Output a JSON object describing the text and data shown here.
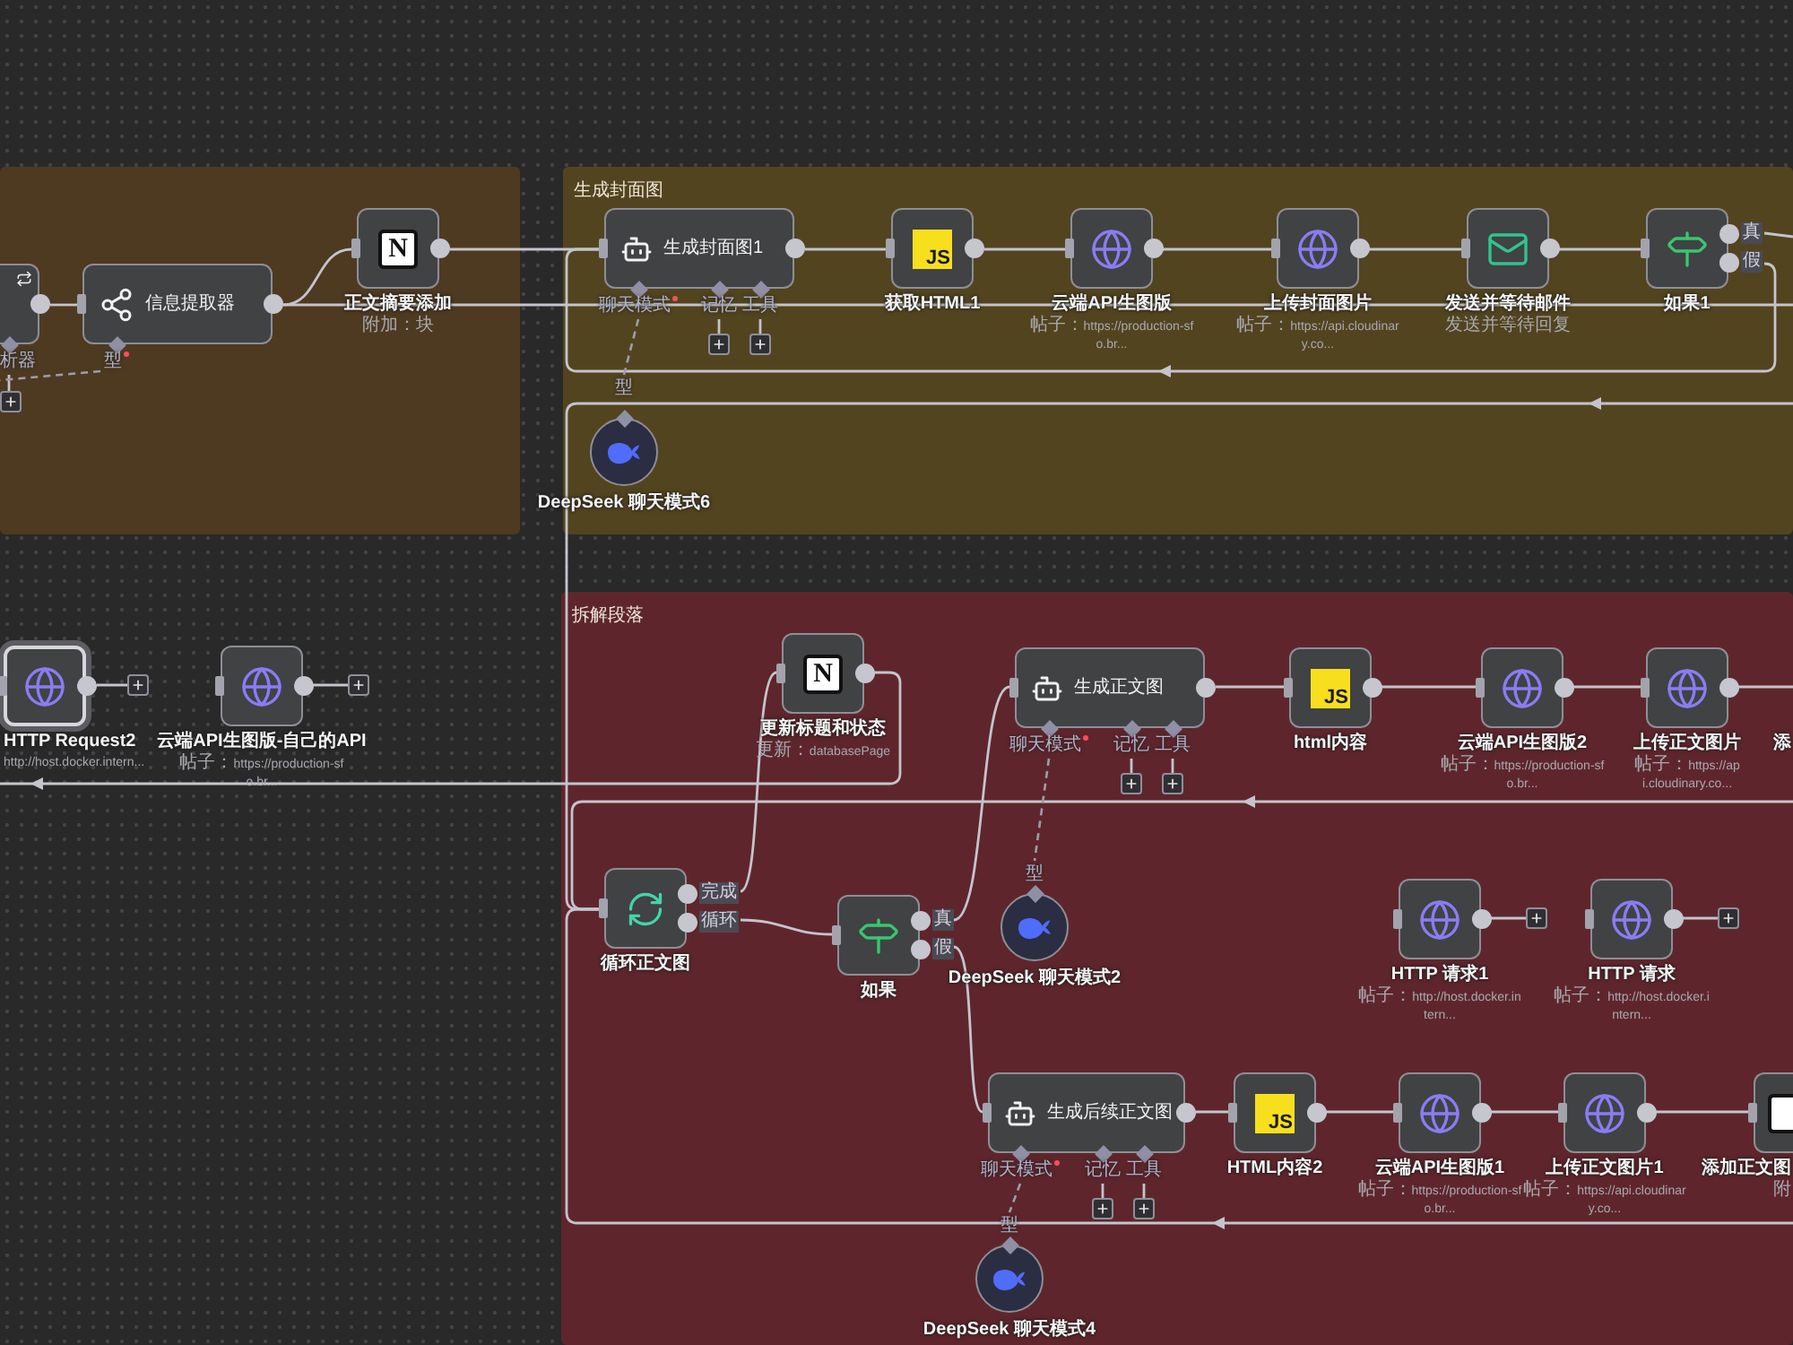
{
  "groups": [
    {
      "color": "#4e3a21"
    },
    {
      "title": "生成封面图",
      "color": "#52441f"
    },
    {
      "title": "拆解段落",
      "color": "#5e262c"
    }
  ],
  "nodes": [
    {
      "kind": "chain",
      "selected": false,
      "ports": [
        {
          "label": "析器",
          "required": false
        }
      ]
    },
    {
      "kind": "extractor",
      "title": "信息提取器",
      "selected": false,
      "ports": [
        {
          "label": "型",
          "required": true
        }
      ]
    },
    {
      "kind": "notion",
      "logo": "N",
      "label": "正文摘要添加",
      "subtitle": "附加：块",
      "selected": false
    },
    {
      "kind": "agent",
      "title": "生成封面图1",
      "selected": false,
      "ports": [
        {
          "label": "聊天模式",
          "required": true
        },
        {
          "label": "记忆",
          "required": false
        },
        {
          "label": "工具",
          "required": false
        }
      ]
    },
    {
      "kind": "code",
      "logo": "JS",
      "label": "获取HTML1",
      "selected": false
    },
    {
      "kind": "http",
      "label": "云端API生图版",
      "subtitle": "帖子：https://production-sfo.br...",
      "selected": false
    },
    {
      "kind": "http",
      "label": "上传封面图片",
      "subtitle": "帖子：https://api.cloudinary.co...",
      "selected": false
    },
    {
      "kind": "email",
      "label": "发送并等待邮件",
      "subtitle": "发送并等待回复",
      "selected": false
    },
    {
      "kind": "if",
      "label": "如果1",
      "outputs": [
        "真",
        "假"
      ],
      "selected": false
    },
    {
      "kind": "model",
      "label": "DeepSeek 聊天模式6",
      "port": "型",
      "selected": false
    },
    {
      "kind": "http",
      "label": "HTTP Request2",
      "subtitle": "http://host.docker.intern...",
      "selected": true
    },
    {
      "kind": "http",
      "label": "云端API生图版-自己的API",
      "subtitle": "帖子：https://production-sfo.br...",
      "selected": false
    },
    {
      "kind": "notion",
      "logo": "N",
      "label": "更新标题和状态",
      "subtitle": "更新：databasePage",
      "selected": false
    },
    {
      "kind": "agent",
      "title": "生成正文图",
      "selected": false,
      "ports": [
        {
          "label": "聊天模式",
          "required": true
        },
        {
          "label": "记忆",
          "required": false
        },
        {
          "label": "工具",
          "required": false
        }
      ]
    },
    {
      "kind": "code",
      "logo": "JS",
      "label": "html内容",
      "selected": false
    },
    {
      "kind": "http",
      "label": "云端API生图版2",
      "subtitle": "帖子：https://production-sfo.br...",
      "selected": false
    },
    {
      "kind": "http",
      "label": "上传正文图片",
      "subtitle": "帖子：https://api.cloudinary.co...",
      "selected": false
    },
    {
      "label": "添"
    },
    {
      "kind": "loop",
      "label": "循环正文图",
      "outputs": [
        "完成",
        "循环"
      ],
      "selected": false
    },
    {
      "kind": "if",
      "label": "如果",
      "outputs": [
        "真",
        "假"
      ],
      "selected": false
    },
    {
      "kind": "model",
      "label": "DeepSeek 聊天模式2",
      "port": "型",
      "selected": false
    },
    {
      "kind": "http",
      "label": "HTTP 请求1",
      "subtitle": "帖子：http://host.docker.intern...",
      "selected": false
    },
    {
      "kind": "http",
      "label": "HTTP 请求",
      "subtitle": "帖子：http://host.docker.intern...",
      "selected": false
    },
    {
      "kind": "agent",
      "title": "生成后续正文图",
      "selected": false,
      "ports": [
        {
          "label": "聊天模式",
          "required": true
        },
        {
          "label": "记忆",
          "required": false
        },
        {
          "label": "工具",
          "required": false
        }
      ]
    },
    {
      "kind": "code",
      "logo": "JS",
      "label": "HTML内容2",
      "selected": false
    },
    {
      "kind": "http",
      "label": "云端API生图版1",
      "subtitle": "帖子：https://production-sfo.br...",
      "selected": false
    },
    {
      "kind": "http",
      "label": "上传正文图片1",
      "subtitle": "帖子：https://api.cloudinary.co...",
      "selected": false
    },
    {
      "kind": "notion",
      "label": "添加正文图",
      "subtitle": "附",
      "selected": false
    },
    {
      "kind": "model",
      "label": "DeepSeek 聊天模式4",
      "port": "型",
      "selected": false
    }
  ]
}
